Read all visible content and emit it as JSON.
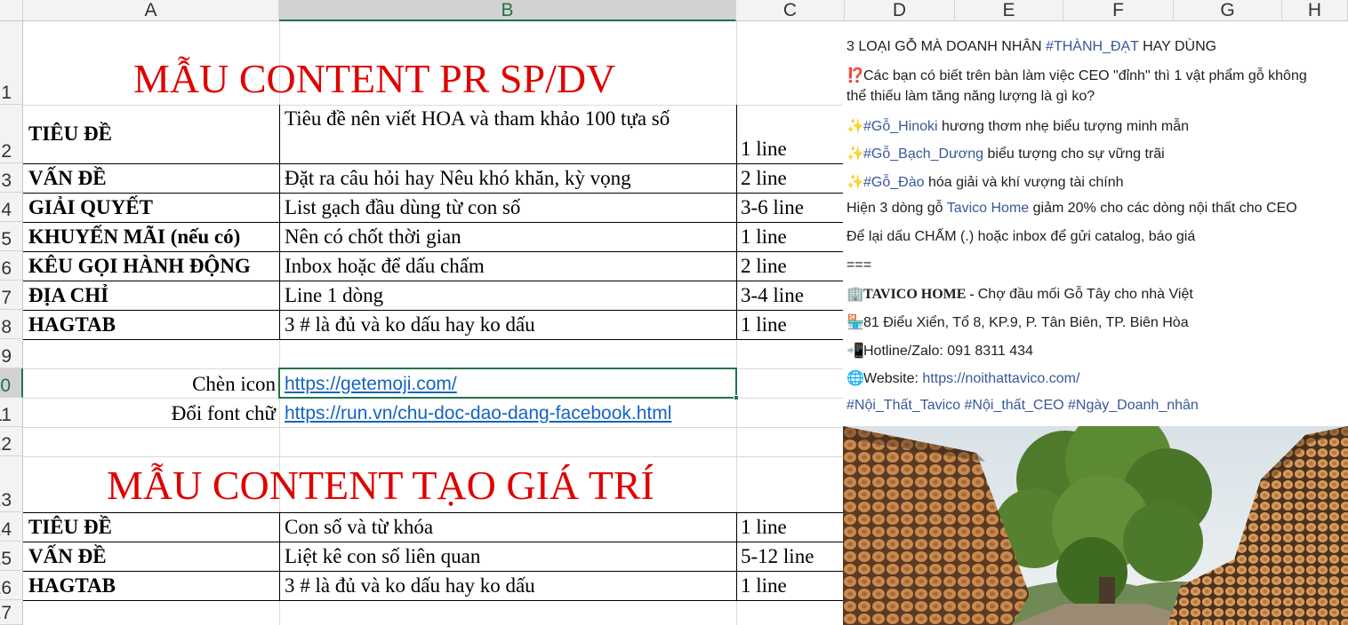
{
  "columns": [
    "A",
    "B",
    "C",
    "D",
    "E",
    "F",
    "G",
    "H"
  ],
  "rows": [
    "1",
    "2",
    "3",
    "4",
    "5",
    "6",
    "7",
    "8",
    "9",
    "10",
    "11",
    "12",
    "13",
    "14",
    "15",
    "16",
    "17"
  ],
  "section1": {
    "title": "MẪU CONTENT PR SP/DV",
    "rows": [
      {
        "a": "TIÊU ĐỀ",
        "b": "Tiêu đề nên viết HOA và tham khảo 100 tựa số",
        "c": "1 line"
      },
      {
        "a": "VẤN ĐỀ",
        "b": "Đặt ra câu hỏi hay Nêu khó khăn, kỳ vọng",
        "c": "2 line"
      },
      {
        "a": "GIẢI QUYẾT",
        "b": "List gạch đầu dùng từ con số",
        "c": "3-6 line"
      },
      {
        "a": "KHUYẾN MÃI (nếu có)",
        "b": "Nên có chốt thời gian",
        "c": "1 line"
      },
      {
        "a": "KÊU GỌI HÀNH ĐỘNG",
        "b": "Inbox hoặc để dấu chấm",
        "c": "2 line"
      },
      {
        "a": "ĐỊA CHỈ",
        "b": "Line 1 dòng",
        "c": "3-4 line"
      },
      {
        "a": "HAGTAB",
        "b": "3 # là đủ và ko dấu hay ko dấu",
        "c": "1 line"
      }
    ]
  },
  "links": {
    "icon_label": "Chèn icon",
    "icon_url": "https://getemoji.com/",
    "font_label": "Đổi font chữ",
    "font_url": "https://run.vn/chu-doc-dao-dang-facebook.html"
  },
  "section2": {
    "title": "MẪU CONTENT TẠO GIÁ TRÍ",
    "rows": [
      {
        "a": "TIÊU ĐỀ",
        "b": "Con số và từ khóa",
        "c": "1 line"
      },
      {
        "a": "VẤN ĐỀ",
        "b": "Liệt kê con số liên quan",
        "c": "5-12 line"
      },
      {
        "a": "HAGTAB",
        "b": "3 # là đủ và ko dấu hay ko dấu",
        "c": "1 line"
      }
    ]
  },
  "post": {
    "headline_pre": "3 LOẠI GỖ MÀ DOANH NHÂN ",
    "headline_tag": "#THÀNH_ĐẠT",
    "headline_post": " HAY DÙNG",
    "question_emoji": "⁉️",
    "question_line1": "Các bạn có biết trên bàn làm việc CEO \"đỉnh\" thì 1 vật phẩm gỗ không",
    "question_line2": "thể thiếu làm tăng năng lượng là gì ko?",
    "sparkle": "✨",
    "item1_tag": "#Gỗ_Hinoki",
    "item1_text": " hương thơm nhẹ biểu tượng minh mẫn",
    "item2_tag": "#Gỗ_Bạch_Dương",
    "item2_text": " biểu tượng cho sự vững trãi",
    "item3_tag": "#Gỗ_Đào",
    "item3_text": " hóa giải và khí vượng tài chính",
    "promo_pre": "Hiện 3 dòng gỗ ",
    "promo_tag": "Tavico Home",
    "promo_post": " giảm 20% cho các dòng nội thất cho CEO",
    "cta": "Để lại dấu CHẤM (.) hoặc inbox để gửi catalog, báo giá",
    "divider": "===",
    "brand_emoji": "🏢",
    "brand_name": "TAVICO HOME - ",
    "brand_desc": "Chợ đầu mối Gỗ Tây cho nhà Việt",
    "address_emoji": "🏪",
    "address": "81 Điểu Xiển, Tổ 8, KP.9, P. Tân Biên, TP. Biên Hòa",
    "phone_emoji": "📲",
    "phone": "Hotline/Zalo: 091 8311 434",
    "web_emoji": "🌐",
    "web_label": "Website: ",
    "web_url": "https://noithattavico.com/",
    "hashtags": "#Nội_Thất_Tavico #Nội_thất_CEO #Ngày_Doanh_nhân"
  }
}
